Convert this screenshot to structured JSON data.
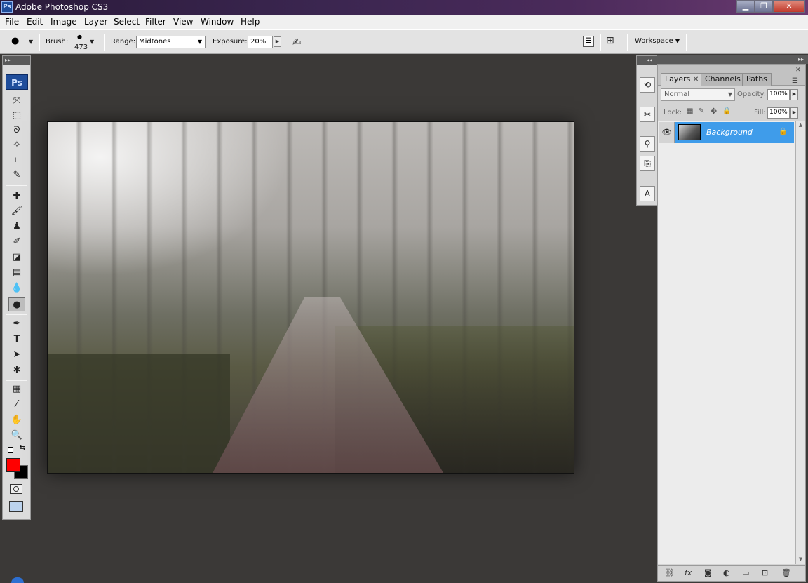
{
  "window": {
    "title": "Adobe Photoshop CS3",
    "app_icon": "Ps",
    "minimize": "▁",
    "maximize": "❐",
    "close": "✕"
  },
  "menu": [
    "File",
    "Edit",
    "Image",
    "Layer",
    "Select",
    "Filter",
    "View",
    "Window",
    "Help"
  ],
  "options": {
    "brush_label": "Brush:",
    "brush_size": "473",
    "range_label": "Range:",
    "range_value": "Midtones",
    "exposure_label": "Exposure:",
    "exposure_value": "20%",
    "workspace_label": "Workspace"
  },
  "toolbox": {
    "badge": "Ps"
  },
  "colors": {
    "foreground": "#ff0000",
    "background": "#000000",
    "selection": "#3f9cea"
  },
  "layers_panel": {
    "tabs": [
      "Layers",
      "Channels",
      "Paths"
    ],
    "blend_mode": "Normal",
    "opacity_label": "Opacity:",
    "opacity_value": "100%",
    "lock_label": "Lock:",
    "fill_label": "Fill:",
    "fill_value": "100%",
    "layers": [
      {
        "name": "Background",
        "visible": true,
        "locked": true
      }
    ]
  }
}
